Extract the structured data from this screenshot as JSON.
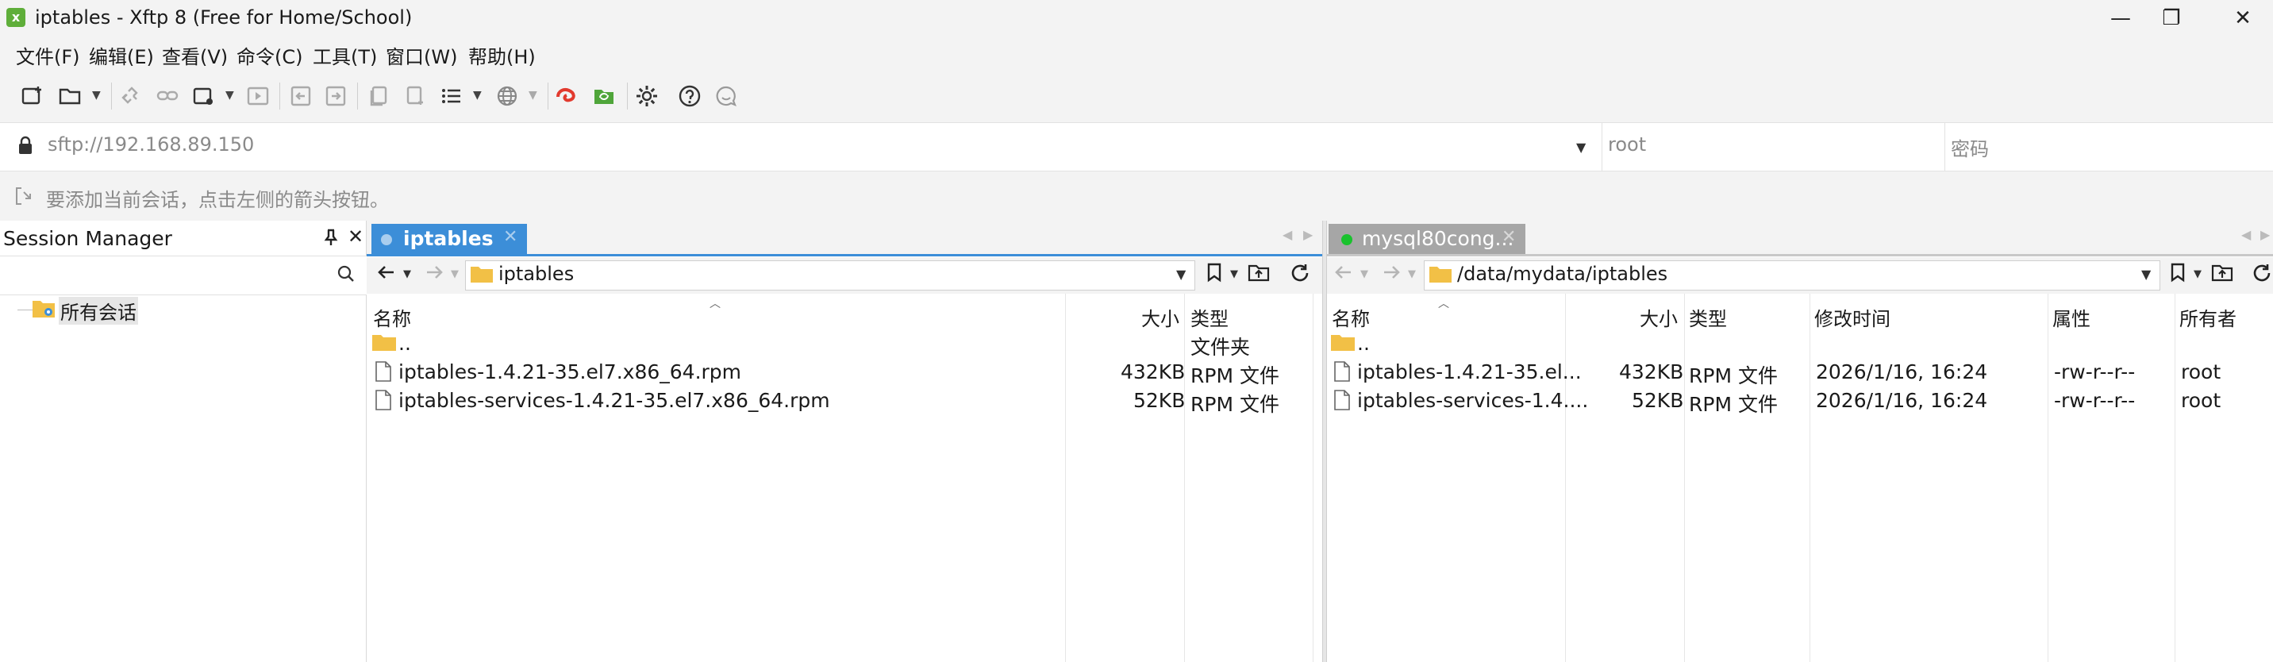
{
  "window": {
    "title": "iptables - Xftp 8 (Free for Home/School)",
    "min_glyph": "—",
    "max_glyph": "❐",
    "close_glyph": "✕",
    "app_icon": "xftp-logo-icon"
  },
  "menu": [
    "文件(F)",
    "编辑(E)",
    "查看(V)",
    "命令(C)",
    "工具(T)",
    "窗口(W)",
    "帮助(H)"
  ],
  "address": {
    "url": "sftp://192.168.89.150",
    "user_placeholder": "root",
    "password_placeholder": "密码"
  },
  "hint": "要添加当前会话，点击左侧的箭头按钮。",
  "session_manager": {
    "title": "Session Manager",
    "tree_root": "所有会话"
  },
  "left_pane": {
    "tab_label": "iptables",
    "path": "iptables",
    "columns": [
      "名称",
      "大小",
      "类型"
    ],
    "rows": [
      {
        "name": "..",
        "size": "",
        "type": "文件夹",
        "kind": "folder"
      },
      {
        "name": "iptables-1.4.21-35.el7.x86_64.rpm",
        "size": "432KB",
        "type": "RPM 文件",
        "kind": "file"
      },
      {
        "name": "iptables-services-1.4.21-35.el7.x86_64.rpm",
        "size": "52KB",
        "type": "RPM 文件",
        "kind": "file"
      }
    ]
  },
  "right_pane": {
    "tab_label": "mysql80cong...",
    "path": "/data/mydata/iptables",
    "columns": [
      "名称",
      "大小",
      "类型",
      "修改时间",
      "属性",
      "所有者"
    ],
    "rows": [
      {
        "name": "..",
        "size": "",
        "type": "",
        "modified": "",
        "attr": "",
        "owner": "",
        "kind": "folder"
      },
      {
        "name": "iptables-1.4.21-35.el...",
        "size": "432KB",
        "type": "RPM 文件",
        "modified": "2026/1/16, 16:24",
        "attr": "-rw-r--r--",
        "owner": "root",
        "kind": "file"
      },
      {
        "name": "iptables-services-1.4....",
        "size": "52KB",
        "type": "RPM 文件",
        "modified": "2026/1/16, 16:24",
        "attr": "-rw-r--r--",
        "owner": "root",
        "kind": "file"
      }
    ]
  },
  "colors": {
    "active_tab": "#3c8ed8",
    "inactive_tab": "#a6a6a6",
    "connected_dot": "#19c22d",
    "folder": "#f2c046"
  }
}
